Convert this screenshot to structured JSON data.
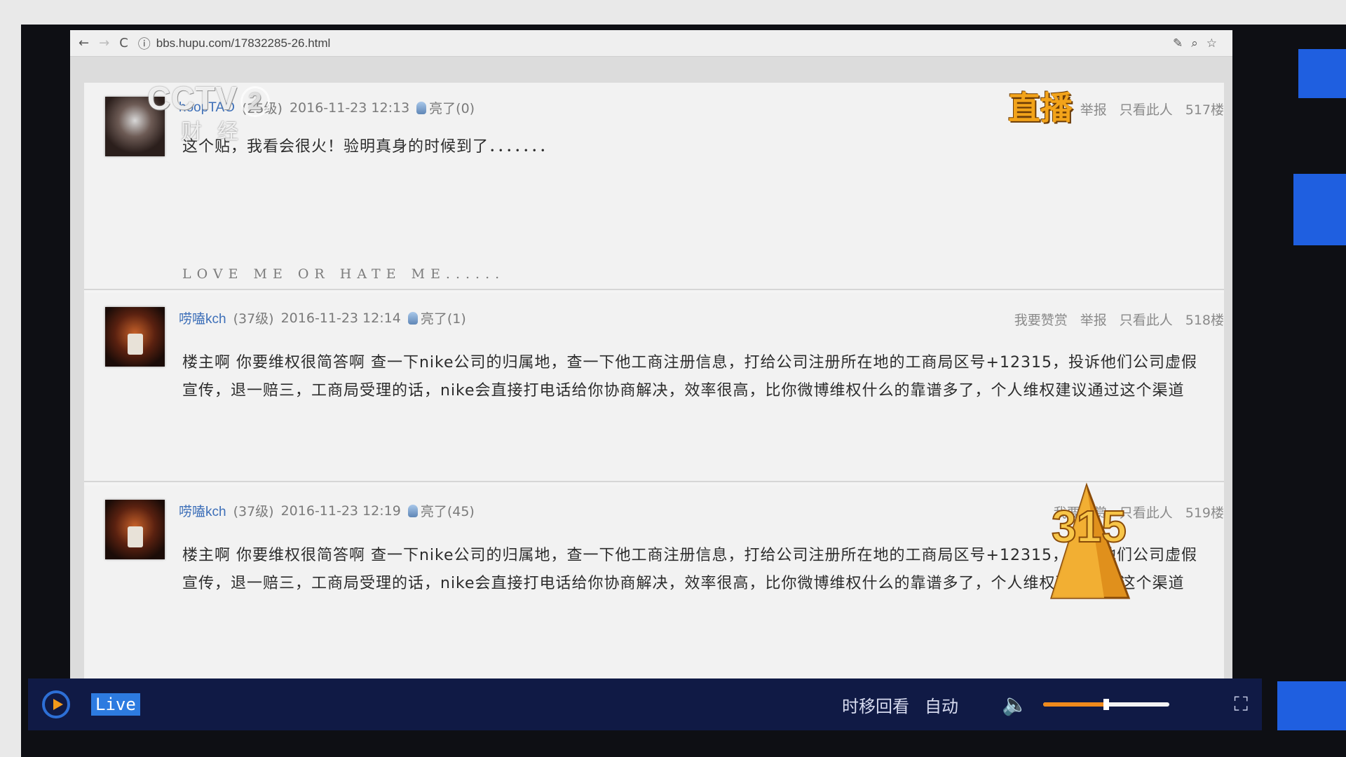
{
  "browser": {
    "url": "bbs.hupu.com/17832285-26.html",
    "back_icon": "←",
    "forward_icon": "→",
    "reload_icon": "C",
    "info_icon": "ⓘ",
    "ext_icons": [
      "✎",
      "⌕",
      "☆"
    ]
  },
  "overlay": {
    "channel_logo": "CCTV",
    "channel_num": "2",
    "channel_sub": "财经",
    "live_badge": "直播",
    "emblem": "315"
  },
  "posts": [
    {
      "username": "hoopTAO",
      "level": "(25级)",
      "datetime": "2016-11-23 12:13",
      "light_label": "亮了(0)",
      "actions": [
        "举报",
        "只看此人"
      ],
      "floor": "517楼",
      "content": "这个贴，我看会很火！验明真身的时候到了．．．．．．．",
      "signature": "LOVE ME OR HATE ME......"
    },
    {
      "username": "唠嗑kch",
      "level": "(37级)",
      "datetime": "2016-11-23 12:14",
      "light_label": "亮了(1)",
      "actions": [
        "我要赞赏",
        "举报",
        "只看此人"
      ],
      "floor": "518楼",
      "content": "楼主啊 你要维权很简答啊 查一下nike公司的归属地，查一下他工商注册信息，打给公司注册所在地的工商局区号+12315，投诉他们公司虚假宣传，退一赔三，工商局受理的话，nike会直接打电话给你协商解决，效率很高，比你微博维权什么的靠谱多了，个人维权建议通过这个渠道"
    },
    {
      "username": "唠嗑kch",
      "level": "(37级)",
      "datetime": "2016-11-23 12:19",
      "light_label": "亮了(45)",
      "actions": [
        "我要赞赏",
        "只看此人"
      ],
      "floor": "519楼",
      "content": "楼主啊 你要维权很简答啊 查一下nike公司的归属地，查一下他工商注册信息，打给公司注册所在地的工商局区号+12315，投诉他们公司虚假宣传，退一赔三，工商局受理的话，nike会直接打电话给你协商解决，效率很高，比你微博维权什么的靠谱多了，个人维权建议通过这个渠道"
    }
  ],
  "player": {
    "live_label": "Live",
    "timeshift_label": "时移回看",
    "auto_label": "自动",
    "volume_icon": "🔈",
    "volume_level": 0.5,
    "fullscreen_icon": "⛶",
    "accent_color": "#f08a1c"
  }
}
